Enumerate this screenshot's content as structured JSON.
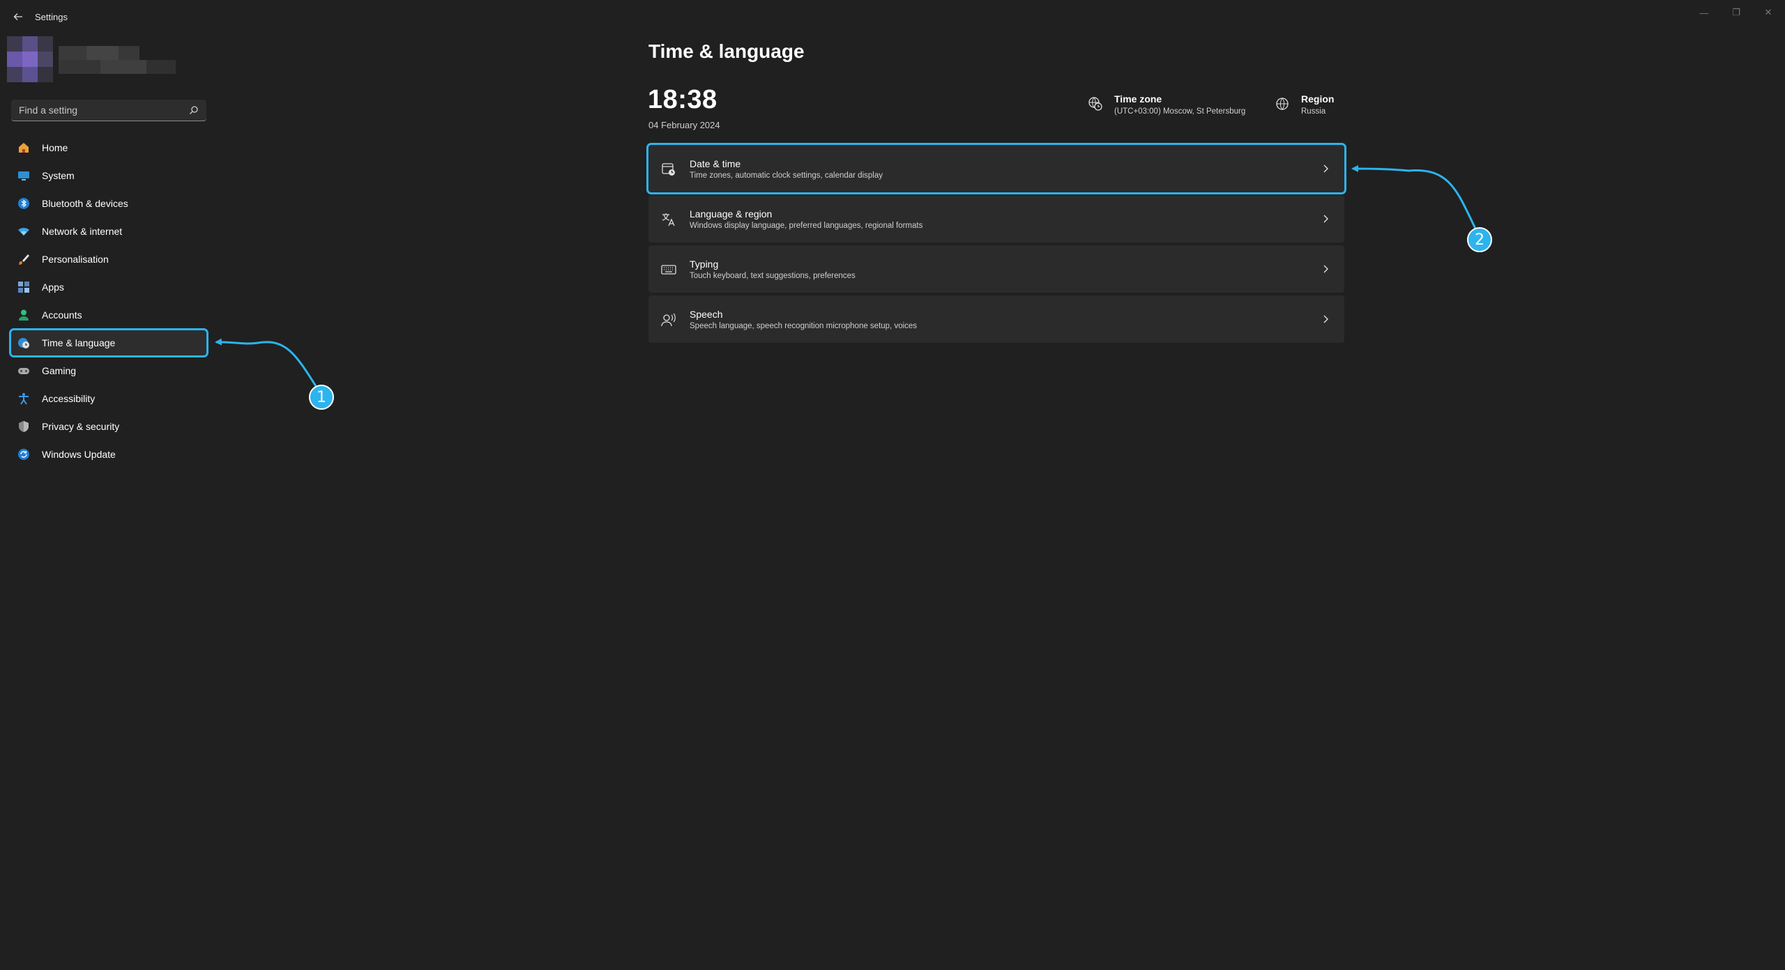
{
  "window": {
    "title": "Settings",
    "controls": {
      "minimize": "—",
      "maximize": "❐",
      "close": "✕"
    }
  },
  "search": {
    "placeholder": "Find a setting"
  },
  "sidebar": {
    "items": [
      {
        "label": "Home",
        "icon": "home-icon"
      },
      {
        "label": "System",
        "icon": "monitor-icon"
      },
      {
        "label": "Bluetooth & devices",
        "icon": "bluetooth-icon"
      },
      {
        "label": "Network & internet",
        "icon": "wifi-icon"
      },
      {
        "label": "Personalisation",
        "icon": "brush-icon"
      },
      {
        "label": "Apps",
        "icon": "apps-icon"
      },
      {
        "label": "Accounts",
        "icon": "person-icon"
      },
      {
        "label": "Time & language",
        "icon": "globe-clock-icon",
        "selected": true
      },
      {
        "label": "Gaming",
        "icon": "gamepad-icon"
      },
      {
        "label": "Accessibility",
        "icon": "accessibility-icon"
      },
      {
        "label": "Privacy & security",
        "icon": "shield-icon"
      },
      {
        "label": "Windows Update",
        "icon": "update-icon"
      }
    ]
  },
  "main": {
    "title": "Time & language",
    "clock": "18:38",
    "date": "04 February 2024",
    "time_zone": {
      "label": "Time zone",
      "value": "(UTC+03:00) Moscow, St Petersburg"
    },
    "region": {
      "label": "Region",
      "value": "Russia"
    },
    "cards": [
      {
        "title": "Date & time",
        "desc": "Time zones, automatic clock settings, calendar display",
        "icon": "calendar-clock-icon"
      },
      {
        "title": "Language & region",
        "desc": "Windows display language, preferred languages, regional formats",
        "icon": "language-icon"
      },
      {
        "title": "Typing",
        "desc": "Touch keyboard, text suggestions, preferences",
        "icon": "keyboard-icon"
      },
      {
        "title": "Speech",
        "desc": "Speech language, speech recognition microphone setup, voices",
        "icon": "speech-icon"
      }
    ]
  },
  "annotations": {
    "step1": "1",
    "step2": "2"
  },
  "colors": {
    "accent": "#2cb4ee",
    "background": "#202020",
    "card": "#2b2b2b"
  }
}
